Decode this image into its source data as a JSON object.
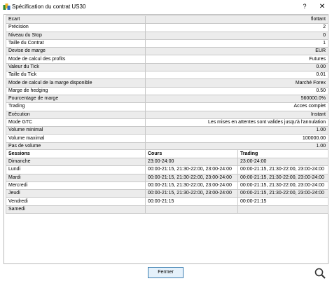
{
  "window": {
    "title": "Spécification du contrat US30",
    "help_label": "?",
    "close_label": "✕"
  },
  "spec_rows": [
    {
      "label": "Ecart",
      "value": "flottant"
    },
    {
      "label": "Précision",
      "value": "2"
    },
    {
      "label": "Niveau du Stop",
      "value": "0"
    },
    {
      "label": "Taille du Contrat",
      "value": "1"
    },
    {
      "label": "Devise de marge",
      "value": "EUR"
    },
    {
      "label": "Mode de calcul des profits",
      "value": "Futures"
    },
    {
      "label": "Valeur du Tick",
      "value": "0.00"
    },
    {
      "label": "Taille du Tick",
      "value": "0.01"
    },
    {
      "label": "Mode de calcul de la marge disponible",
      "value": "Marché Forex"
    },
    {
      "label": "Marge de hedging",
      "value": "0.50"
    },
    {
      "label": "Pourcentage de marge",
      "value": "560000.0%"
    },
    {
      "label": "Trading",
      "value": "Acces complet"
    },
    {
      "label": "Exécution",
      "value": "Instant"
    },
    {
      "label": "Mode GTC",
      "value": "Les mises en attentes sont valides jusqu'à l'annulation"
    },
    {
      "label": "Volume minimal",
      "value": "1.00"
    },
    {
      "label": "Volume maximal",
      "value": "100000.00"
    },
    {
      "label": "Pas de volume",
      "value": "1.00"
    }
  ],
  "sessions": {
    "headers": [
      "Sessions",
      "Cours",
      "Trading"
    ],
    "rows": [
      {
        "day": "Dimanche",
        "quotes": "23:00-24:00",
        "trading": "23:00-24:00"
      },
      {
        "day": "Lundi",
        "quotes": "00:00-21:15, 21:30-22:00, 23:00-24:00",
        "trading": "00:00-21:15, 21:30-22:00, 23:00-24:00"
      },
      {
        "day": "Mardi",
        "quotes": "00:00-21:15, 21:30-22:00, 23:00-24:00",
        "trading": "00:00-21:15, 21:30-22:00, 23:00-24:00"
      },
      {
        "day": "Mercredi",
        "quotes": "00:00-21:15, 21:30-22:00, 23:00-24:00",
        "trading": "00:00-21:15, 21:30-22:00, 23:00-24:00"
      },
      {
        "day": "Jeudi",
        "quotes": "00:00-21:15, 21:30-22:00, 23:00-24:00",
        "trading": "00:00-21:15, 21:30-22:00, 23:00-24:00"
      },
      {
        "day": "Vendredi",
        "quotes": "00:00-21:15",
        "trading": "00:00-21:15"
      },
      {
        "day": "Samedi",
        "quotes": "",
        "trading": ""
      }
    ]
  },
  "footer": {
    "close_button_label": "Fermer"
  },
  "icons": {
    "app": "metatrader-app-icon",
    "zoom": "magnifier-icon"
  }
}
